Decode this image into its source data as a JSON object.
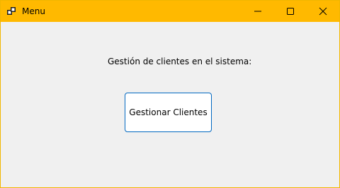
{
  "window": {
    "title": "Menu",
    "accent_color": "#ffb900",
    "background_color": "#f0f0f0"
  },
  "titlebar": {
    "app_icon": "application-icon",
    "minimize_icon": "minimize-icon",
    "maximize_icon": "maximize-icon",
    "close_icon": "close-icon"
  },
  "main": {
    "label": "Gestión de clientes en el sistema:",
    "button_label": "Gestionar Clientes",
    "button_border_color": "#0067c0"
  }
}
